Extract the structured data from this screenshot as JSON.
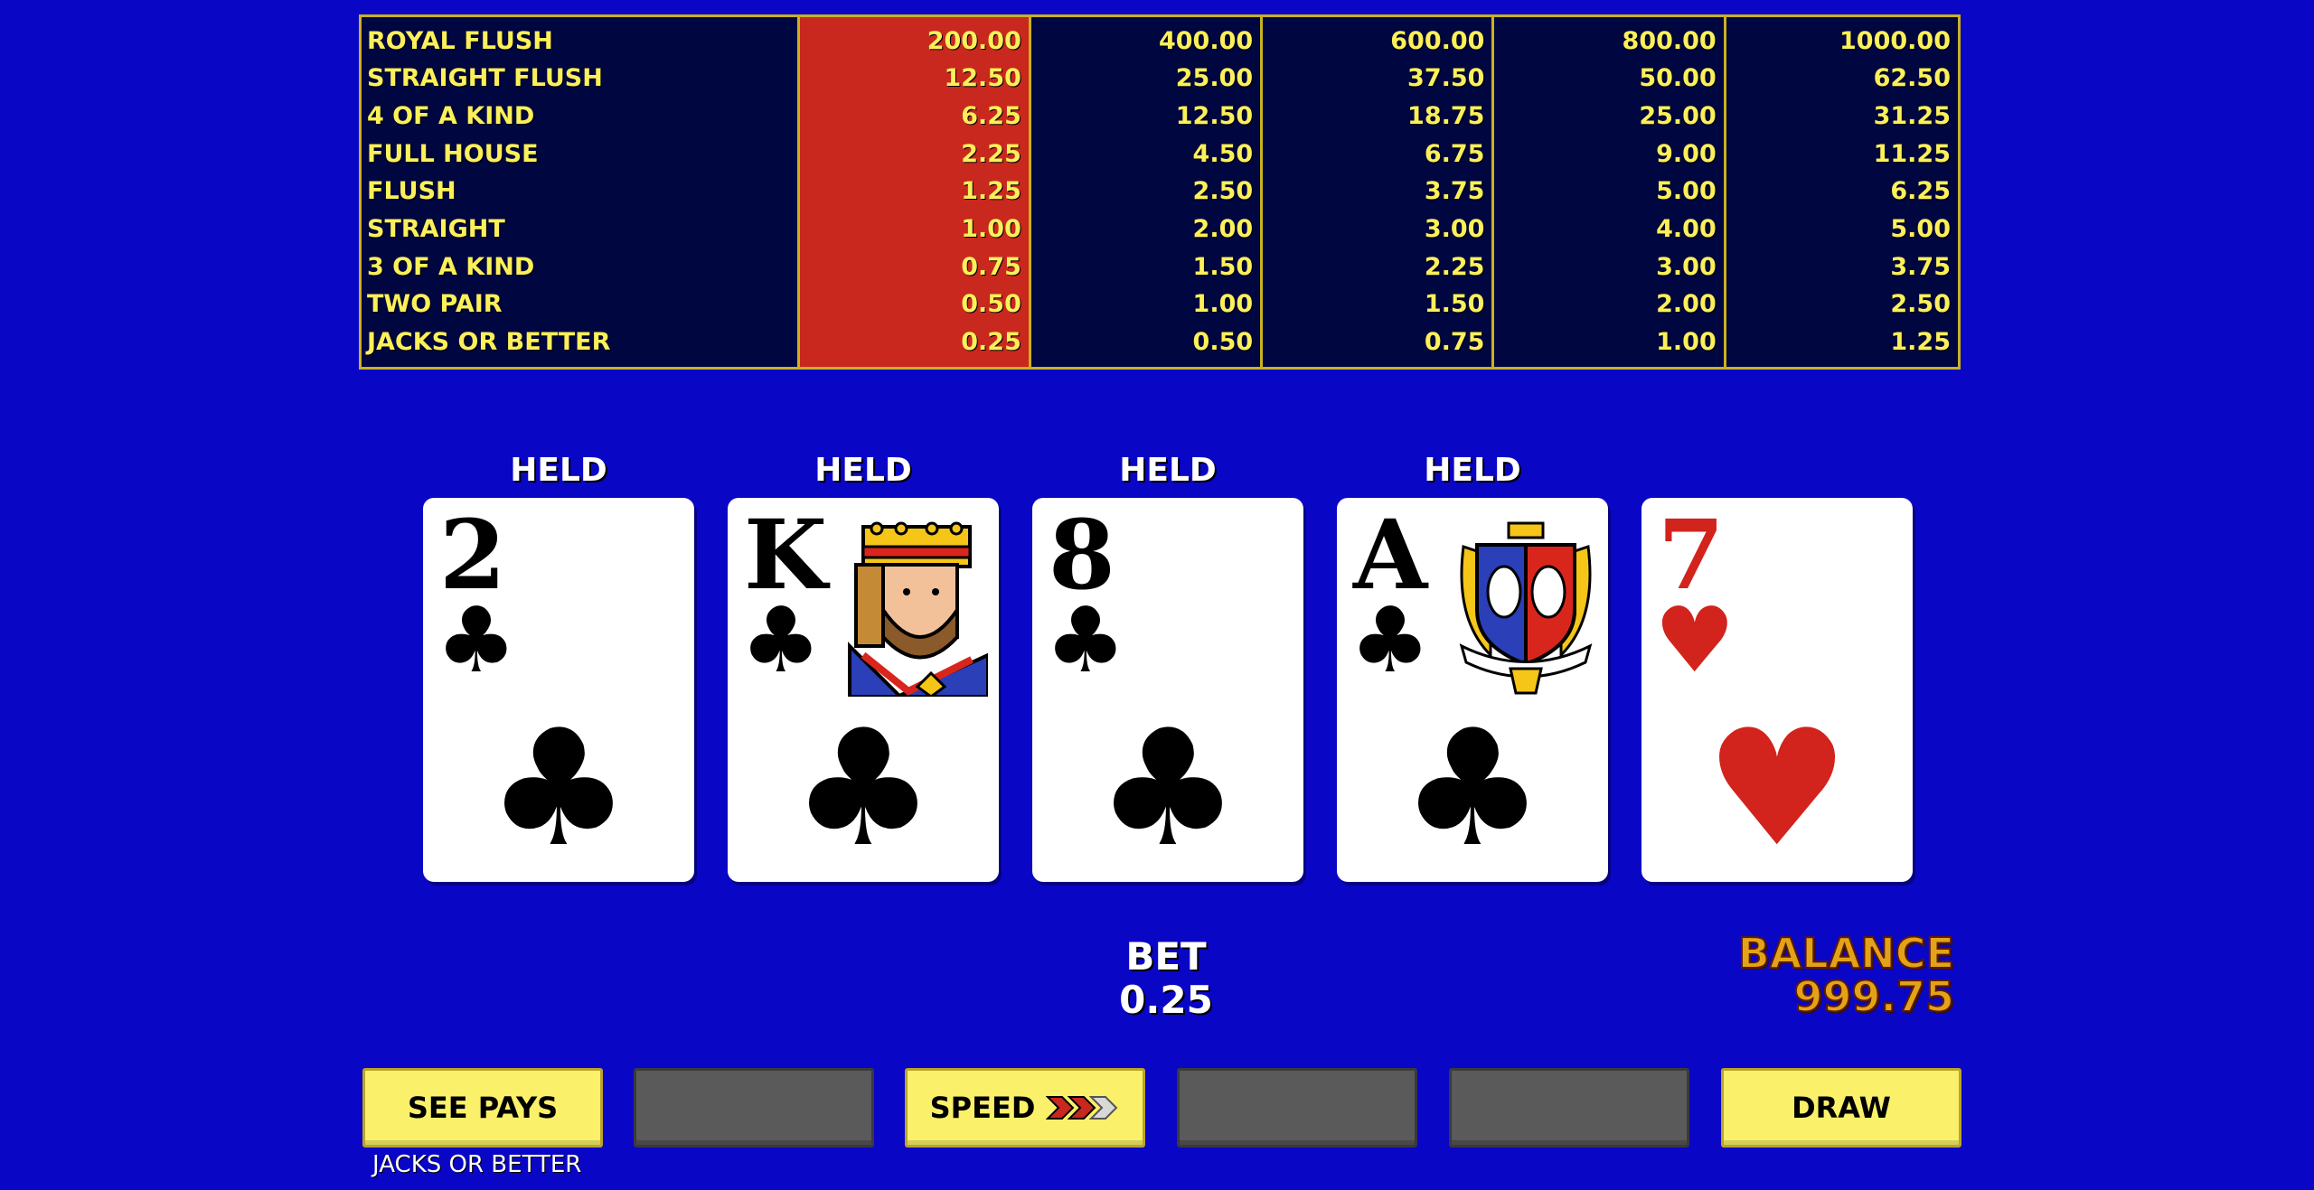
{
  "paytable": {
    "hands": [
      "ROYAL FLUSH",
      "STRAIGHT FLUSH",
      "4 OF A KIND",
      "FULL HOUSE",
      "FLUSH",
      "STRAIGHT",
      "3 OF A KIND",
      "TWO PAIR",
      "JACKS OR BETTER"
    ],
    "columns": [
      [
        "200.00",
        "12.50",
        "6.25",
        "2.25",
        "1.25",
        "1.00",
        "0.75",
        "0.50",
        "0.25"
      ],
      [
        "400.00",
        "25.00",
        "12.50",
        "4.50",
        "2.50",
        "2.00",
        "1.50",
        "1.00",
        "0.50"
      ],
      [
        "600.00",
        "37.50",
        "18.75",
        "6.75",
        "3.75",
        "3.00",
        "2.25",
        "1.50",
        "0.75"
      ],
      [
        "800.00",
        "50.00",
        "25.00",
        "9.00",
        "5.00",
        "4.00",
        "3.00",
        "2.00",
        "1.00"
      ],
      [
        "1000.00",
        "62.50",
        "31.25",
        "11.25",
        "6.25",
        "5.00",
        "3.75",
        "2.50",
        "1.25"
      ]
    ],
    "active_column": 0,
    "colors": {
      "border": "#c9b21f",
      "active": "#c8281e",
      "text": "#fbf05a",
      "background": "#00063f"
    }
  },
  "cards": [
    {
      "rank": "2",
      "suit": "♣",
      "color": "black",
      "held": "HELD",
      "face": ""
    },
    {
      "rank": "K",
      "suit": "♣",
      "color": "black",
      "held": "HELD",
      "face": "king-portrait"
    },
    {
      "rank": "8",
      "suit": "♣",
      "color": "black",
      "held": "HELD",
      "face": ""
    },
    {
      "rank": "A",
      "suit": "♣",
      "color": "black",
      "held": "HELD",
      "face": "coat-of-arms"
    },
    {
      "rank": "7",
      "suit": "♥",
      "color": "red",
      "held": "",
      "face": ""
    }
  ],
  "bet": {
    "label": "BET",
    "value": "0.25"
  },
  "balance": {
    "label": "BALANCE",
    "value": "999.75"
  },
  "buttons": {
    "see_pays": "SEE PAYS",
    "speed": "SPEED",
    "draw": "DRAW"
  },
  "game_name": "JACKS OR BETTER",
  "background": "#0a06c6"
}
